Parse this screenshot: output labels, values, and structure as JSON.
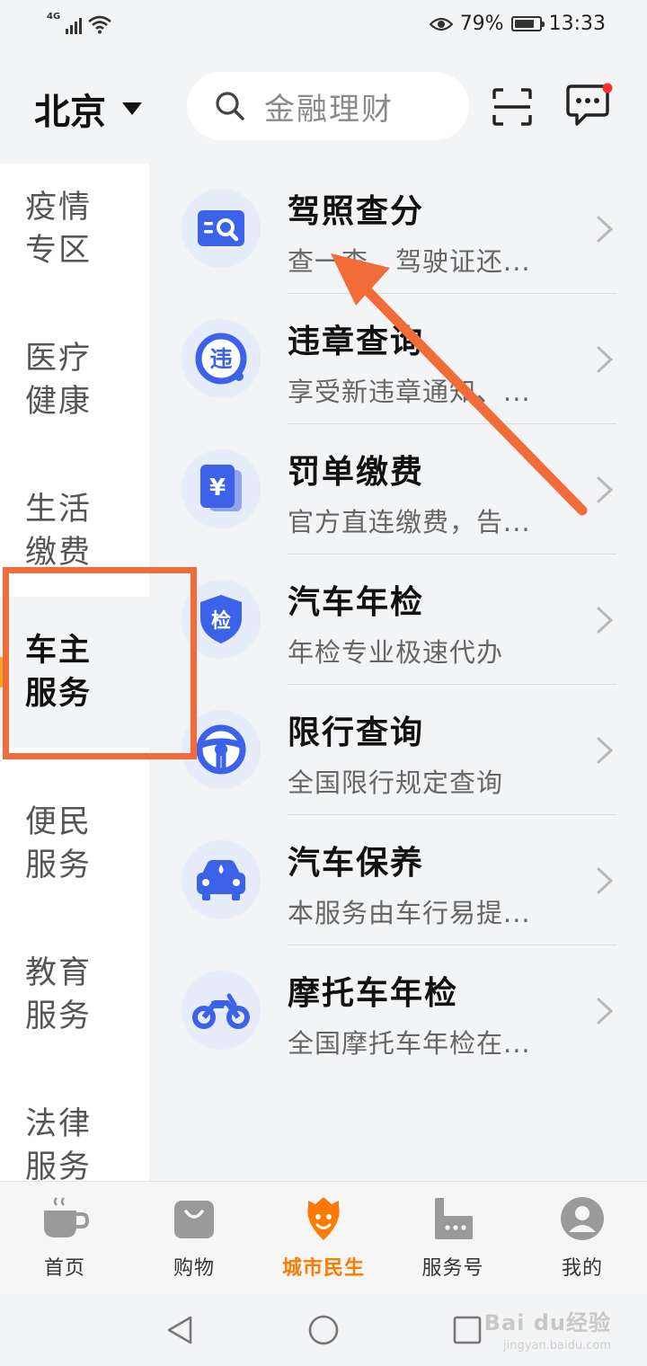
{
  "status_bar": {
    "network": "4G",
    "battery": "79%",
    "battery_level": 0.79,
    "time": "13:33"
  },
  "header": {
    "city": "北京",
    "search_placeholder": "金融理财",
    "has_unread_message": true
  },
  "sidebar": {
    "items": [
      {
        "label": "疫情专区",
        "active": false
      },
      {
        "label": "医疗健康",
        "active": false
      },
      {
        "label": "生活缴费",
        "active": false
      },
      {
        "label": "车主服务",
        "active": true
      },
      {
        "label": "便民服务",
        "active": false
      },
      {
        "label": "教育服务",
        "active": false
      },
      {
        "label": "法律服务",
        "active": false
      }
    ]
  },
  "services": [
    {
      "title": "驾照查分",
      "subtitle": "查一查，驾驶证还...",
      "icon": "license-score-icon"
    },
    {
      "title": "违章查询",
      "subtitle": "享受新违章通知、...",
      "icon": "violation-query-icon"
    },
    {
      "title": "罚单缴费",
      "subtitle": "官方直连缴费，告...",
      "icon": "fine-payment-icon"
    },
    {
      "title": "汽车年检",
      "subtitle": "年检专业极速代办",
      "icon": "annual-inspection-icon"
    },
    {
      "title": "限行查询",
      "subtitle": "全国限行规定查询",
      "icon": "traffic-restriction-icon"
    },
    {
      "title": "汽车保养",
      "subtitle": "本服务由车行易提...",
      "icon": "car-maintenance-icon"
    },
    {
      "title": "摩托车年检",
      "subtitle": "全国摩托车年检在...",
      "icon": "motorcycle-inspection-icon"
    }
  ],
  "icon_glyphs": {
    "fine": "¥",
    "inspection": "检",
    "violation": "违"
  },
  "tabbar": {
    "items": [
      {
        "label": "首页",
        "icon": "coffee-cup-icon",
        "active": false
      },
      {
        "label": "购物",
        "icon": "shopping-bag-icon",
        "active": false
      },
      {
        "label": "城市民生",
        "icon": "city-life-icon",
        "active": true
      },
      {
        "label": "服务号",
        "icon": "service-account-icon",
        "active": false
      },
      {
        "label": "我的",
        "icon": "profile-avatar-icon",
        "active": false
      }
    ]
  },
  "watermark": {
    "text": "Bai du经验",
    "sub": "jingyan.baidu.com"
  },
  "colors": {
    "accent_orange": "#ff7a00",
    "annotation": "#f26c3a",
    "icon_blue": "#3b62e8",
    "icon_bg": "#e7ecfb",
    "notification_dot": "#ff2d2d"
  }
}
